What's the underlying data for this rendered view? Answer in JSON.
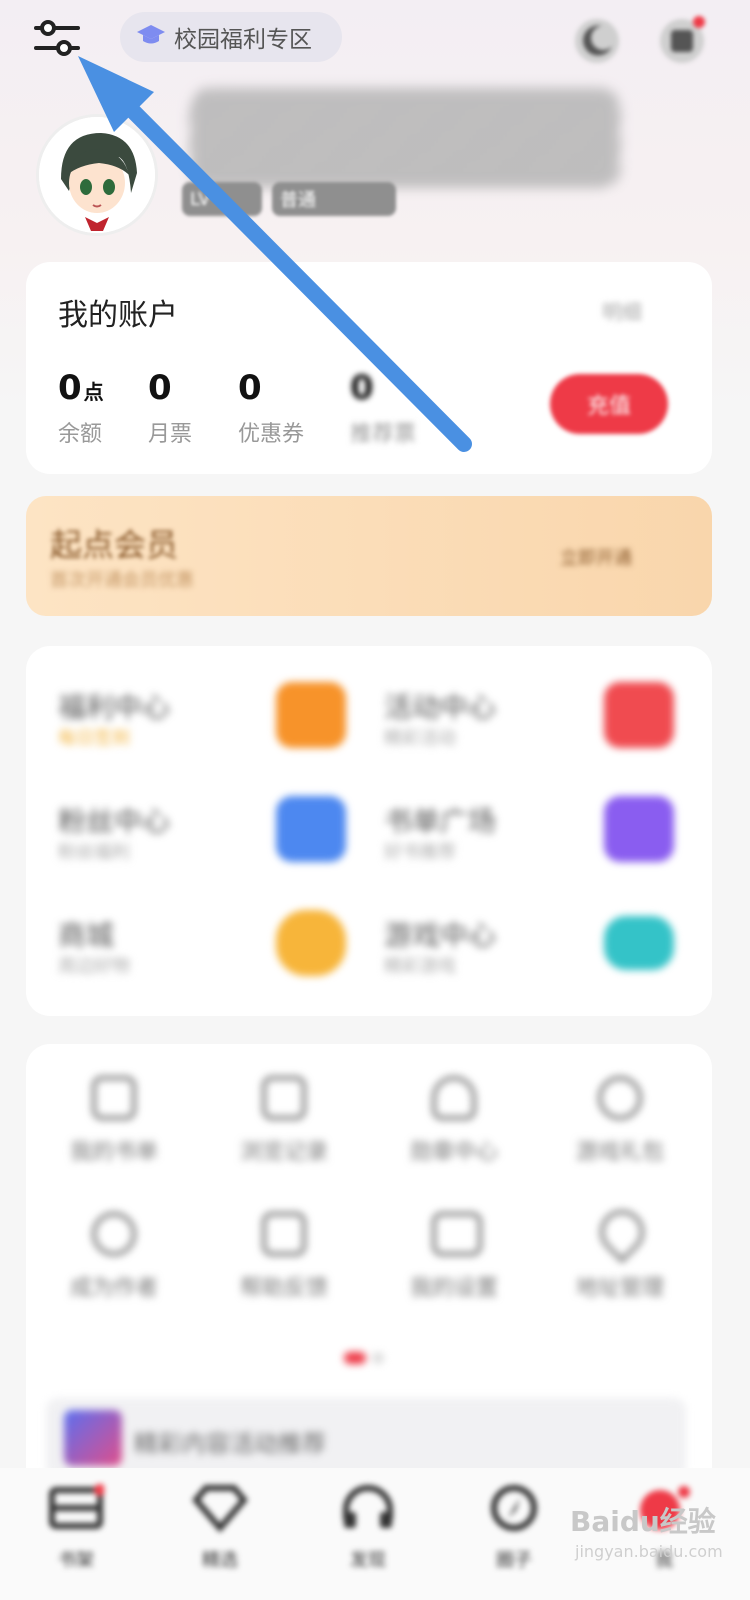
{
  "header": {
    "campus_label": "校园福利专区"
  },
  "profile": {
    "level_tag": "LV",
    "user_tag": "普通"
  },
  "account": {
    "title": "我的账户",
    "detail_label": "明细",
    "stats": [
      {
        "value": "0",
        "unit": "点",
        "label": "余额"
      },
      {
        "value": "0",
        "unit": "",
        "label": "月票"
      },
      {
        "value": "0",
        "unit": "",
        "label": "优惠券"
      },
      {
        "value": "0",
        "unit": "",
        "label": "推荐票"
      }
    ],
    "recharge_label": "充值"
  },
  "member": {
    "title": "起点会员",
    "subtitle": "首次开通会员优惠",
    "action_label": "立即开通"
  },
  "grid": {
    "items": [
      {
        "title": "福利中心",
        "sub": "每日签到",
        "tile_color": "#f7932a"
      },
      {
        "title": "活动中心",
        "sub": "精彩活动",
        "tile_color": "#f04b50"
      },
      {
        "title": "粉丝中心",
        "sub": "粉丝福利",
        "tile_color": "#4d88f0"
      },
      {
        "title": "书单广场",
        "sub": "好书推荐",
        "tile_color": "#8a5df0"
      },
      {
        "title": "商城",
        "sub": "周边好物",
        "tile_color": "#f7b53a"
      },
      {
        "title": "游戏中心",
        "sub": "精彩游戏",
        "tile_color": "#34c3c8"
      }
    ]
  },
  "icons": {
    "row1": [
      "我的书单",
      "浏览记录",
      "勋章中心",
      "游戏礼包"
    ],
    "row2": [
      "成为作者",
      "帮助反馈",
      "我的设置",
      "地址管理"
    ]
  },
  "banner": {
    "text": "精彩内容活动推荐"
  },
  "nav": {
    "items": [
      "书架",
      "精选",
      "发现",
      "圈子",
      "我"
    ]
  },
  "watermark": {
    "logo": "Baidu经验",
    "url": "jingyan.baidu.com"
  },
  "colors": {
    "annotation_arrow": "#4a90e2",
    "accent_red": "#ee3a47"
  }
}
